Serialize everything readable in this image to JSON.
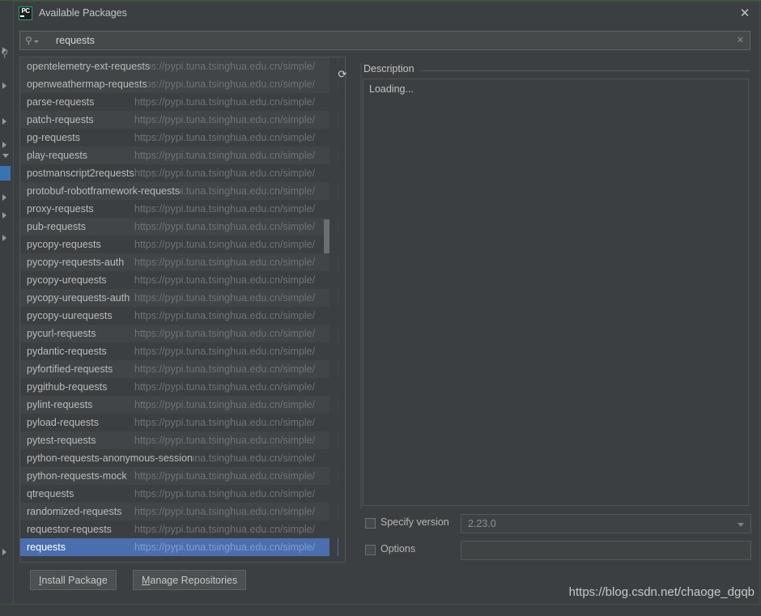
{
  "window": {
    "title": "Available Packages",
    "app_icon": "pycharm-icon",
    "close_icon": "✕"
  },
  "search": {
    "icon": "search-icon",
    "value": "requests",
    "placeholder": "",
    "clear_icon": "✕"
  },
  "list": {
    "refresh_icon": "⟳",
    "default_repo_url": "https://pypi.tuna.tsinghua.edu.cn/simple/",
    "rows": [
      {
        "name": "opentelemetry-ext-requests",
        "url": "https://pypi.tuna.tsinghua.edu.cn/simple/",
        "alt": true,
        "selected": false,
        "long": true
      },
      {
        "name": "openweathermap-requests",
        "url": "https://pypi.tuna.tsinghua.edu.cn/simple/",
        "alt": true,
        "selected": false,
        "long": true
      },
      {
        "name": "parse-requests",
        "url": "https://pypi.tuna.tsinghua.edu.cn/simple/",
        "alt": false,
        "selected": false,
        "long": false
      },
      {
        "name": "patch-requests",
        "url": "https://pypi.tuna.tsinghua.edu.cn/simple/",
        "alt": true,
        "selected": false,
        "long": false
      },
      {
        "name": "pg-requests",
        "url": "https://pypi.tuna.tsinghua.edu.cn/simple/",
        "alt": false,
        "selected": false,
        "long": false
      },
      {
        "name": "play-requests",
        "url": "https://pypi.tuna.tsinghua.edu.cn/simple/",
        "alt": true,
        "selected": false,
        "long": false
      },
      {
        "name": "postmanscript2requests",
        "url": "https://pypi.tuna.tsinghua.edu.cn/simple/",
        "alt": false,
        "selected": false,
        "long": true
      },
      {
        "name": "protobuf-robotframework-requests",
        "url": "https://pypi.tuna.tsinghua.edu.cn/simple/",
        "alt": true,
        "selected": false,
        "long": true
      },
      {
        "name": "proxy-requests",
        "url": "https://pypi.tuna.tsinghua.edu.cn/simple/",
        "alt": false,
        "selected": false,
        "long": false
      },
      {
        "name": "pub-requests",
        "url": "https://pypi.tuna.tsinghua.edu.cn/simple/",
        "alt": true,
        "selected": false,
        "long": false
      },
      {
        "name": "pycopy-requests",
        "url": "https://pypi.tuna.tsinghua.edu.cn/simple/",
        "alt": false,
        "selected": false,
        "long": false
      },
      {
        "name": "pycopy-requests-auth",
        "url": "https://pypi.tuna.tsinghua.edu.cn/simple/",
        "alt": true,
        "selected": false,
        "long": false
      },
      {
        "name": "pycopy-urequests",
        "url": "https://pypi.tuna.tsinghua.edu.cn/simple/",
        "alt": false,
        "selected": false,
        "long": false
      },
      {
        "name": "pycopy-urequests-auth",
        "url": "https://pypi.tuna.tsinghua.edu.cn/simple/",
        "alt": true,
        "selected": false,
        "long": true
      },
      {
        "name": "pycopy-uurequests",
        "url": "https://pypi.tuna.tsinghua.edu.cn/simple/",
        "alt": false,
        "selected": false,
        "long": false
      },
      {
        "name": "pycurl-requests",
        "url": "https://pypi.tuna.tsinghua.edu.cn/simple/",
        "alt": true,
        "selected": false,
        "long": false
      },
      {
        "name": "pydantic-requests",
        "url": "https://pypi.tuna.tsinghua.edu.cn/simple/",
        "alt": false,
        "selected": false,
        "long": false
      },
      {
        "name": "pyfortified-requests",
        "url": "https://pypi.tuna.tsinghua.edu.cn/simple/",
        "alt": true,
        "selected": false,
        "long": false
      },
      {
        "name": "pygithub-requests",
        "url": "https://pypi.tuna.tsinghua.edu.cn/simple/",
        "alt": false,
        "selected": false,
        "long": false
      },
      {
        "name": "pylint-requests",
        "url": "https://pypi.tuna.tsinghua.edu.cn/simple/",
        "alt": true,
        "selected": false,
        "long": false
      },
      {
        "name": "pyload-requests",
        "url": "https://pypi.tuna.tsinghua.edu.cn/simple/",
        "alt": false,
        "selected": false,
        "long": false
      },
      {
        "name": "pytest-requests",
        "url": "https://pypi.tuna.tsinghua.edu.cn/simple/",
        "alt": true,
        "selected": false,
        "long": false
      },
      {
        "name": "python-requests-anonymous-session",
        "url": "https://pypi.tuna.tsinghua.edu.cn/simple/",
        "alt": false,
        "selected": false,
        "long": true
      },
      {
        "name": "python-requests-mock",
        "url": "https://pypi.tuna.tsinghua.edu.cn/simple/",
        "alt": true,
        "selected": false,
        "long": true
      },
      {
        "name": "qtrequests",
        "url": "https://pypi.tuna.tsinghua.edu.cn/simple/",
        "alt": false,
        "selected": false,
        "long": false
      },
      {
        "name": "randomized-requests",
        "url": "https://pypi.tuna.tsinghua.edu.cn/simple/",
        "alt": true,
        "selected": false,
        "long": false
      },
      {
        "name": "requestor-requests",
        "url": "https://pypi.tuna.tsinghua.edu.cn/simple/",
        "alt": false,
        "selected": false,
        "long": false
      },
      {
        "name": "requests",
        "url": "https://pypi.tuna.tsinghua.edu.cn/simple/",
        "alt": false,
        "selected": true,
        "long": false
      }
    ]
  },
  "description": {
    "label": "Description",
    "body": "Loading..."
  },
  "version": {
    "checkbox_label": "Specify version",
    "checked": false,
    "selected_value": "2.23.0",
    "options": [
      "2.23.0"
    ]
  },
  "options": {
    "checkbox_label": "Options",
    "checked": false,
    "value": "",
    "placeholder": ""
  },
  "footer": {
    "install_mnemonic": "I",
    "install_rest": "nstall Package",
    "manage_mnemonic": "M",
    "manage_rest": "anage Repositories"
  },
  "watermark": {
    "text": "https://blog.csdn.net/chaoge_dgqb"
  },
  "colors": {
    "dialog_bg": "#3c3f41",
    "row_alt": "#414547",
    "selection": "#4b6eaf",
    "text": "#bbbbbb",
    "muted_text": "#6f7375",
    "border": "#4f5456",
    "ide_green": "#2f5f2f"
  }
}
